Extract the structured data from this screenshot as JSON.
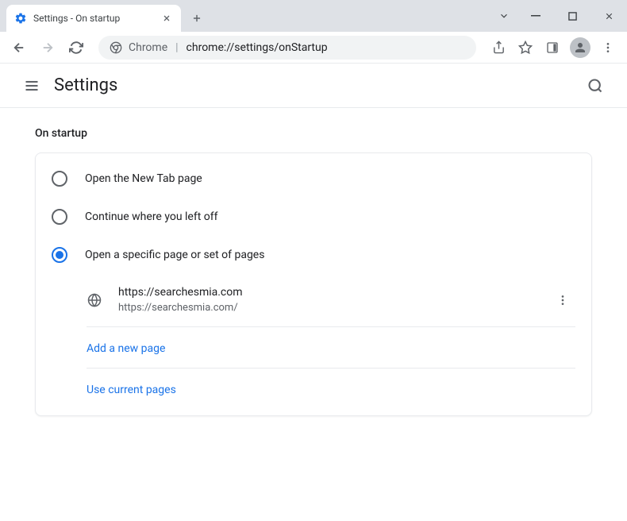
{
  "tab": {
    "title": "Settings - On startup"
  },
  "omnibox": {
    "prefix": "Chrome",
    "url": "chrome://settings/onStartup"
  },
  "header": {
    "title": "Settings"
  },
  "section": {
    "title": "On startup"
  },
  "options": {
    "newTab": "Open the New Tab page",
    "continue": "Continue where you left off",
    "specific": "Open a specific page or set of pages"
  },
  "pages": [
    {
      "name": "https://searchesmia.com",
      "url": "https://searchesmia.com/"
    }
  ],
  "actions": {
    "addPage": "Add a new page",
    "useCurrent": "Use current pages"
  }
}
